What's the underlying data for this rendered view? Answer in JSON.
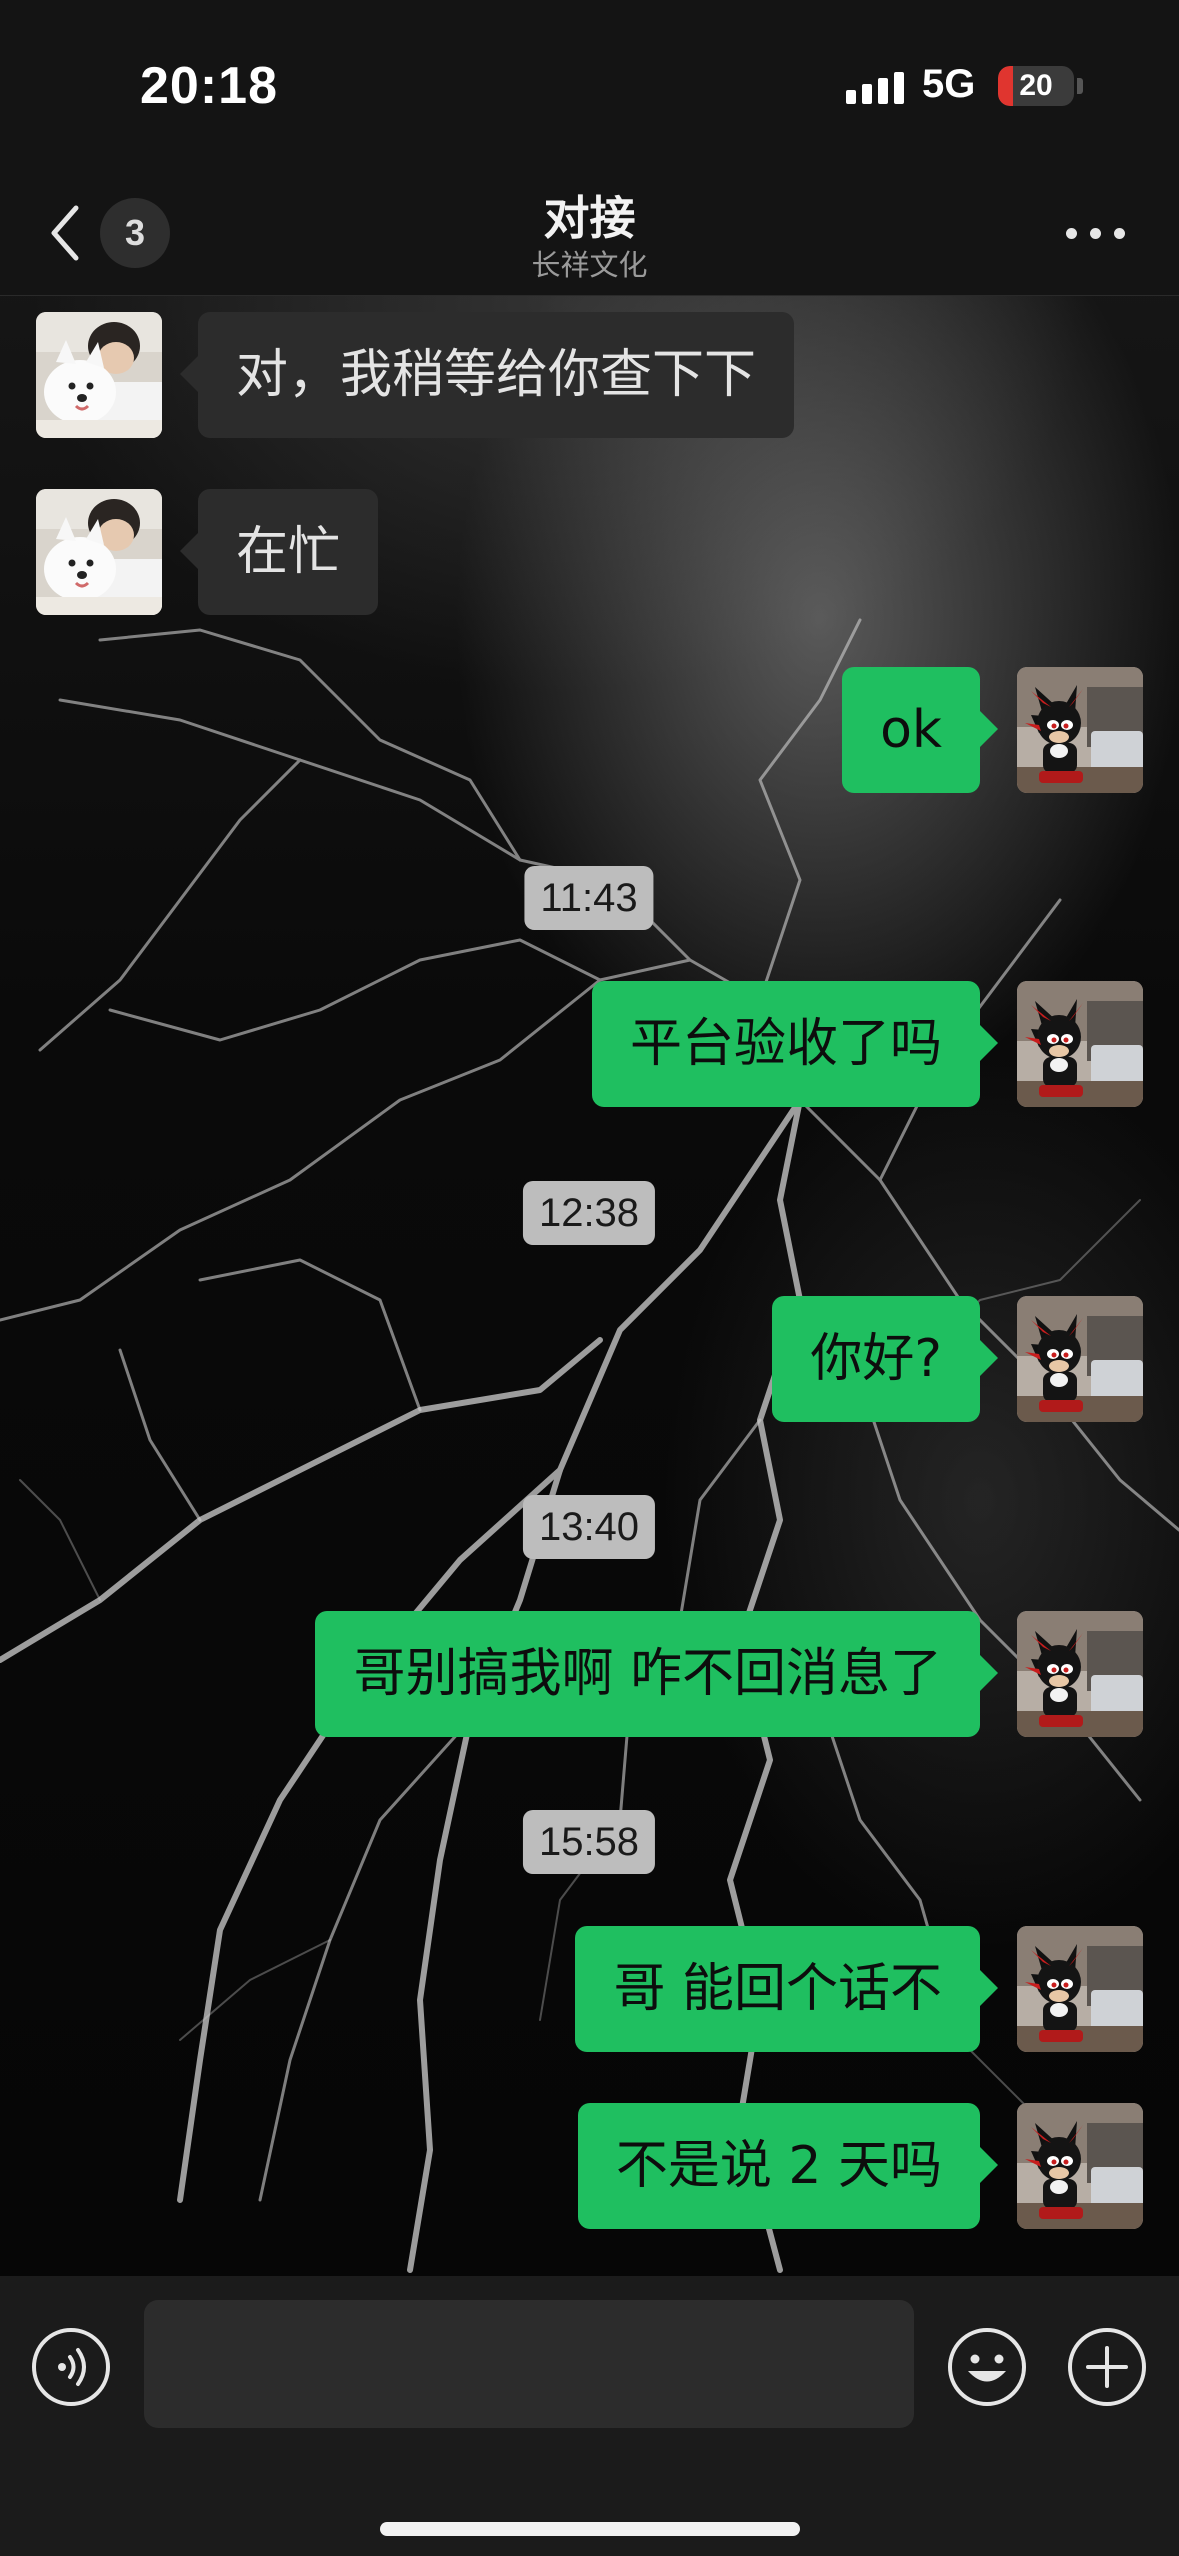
{
  "status_bar": {
    "time": "20:18",
    "network": "5G",
    "battery_level": 20,
    "battery_text": "20",
    "battery_color": "#e0352f"
  },
  "nav": {
    "back_icon": "chevron-left-icon",
    "unread_count": "3",
    "title": "对接",
    "subtitle": "长祥文化",
    "more_icon": "more-dots-icon"
  },
  "colors": {
    "outgoing_bubble": "#1fbf60",
    "incoming_bubble": "#2c2c2c",
    "timestamp_bg": "#bdbdbd"
  },
  "messages": [
    {
      "direction": "in",
      "avatar": "dog-and-person-avatar",
      "text": "对，我稍等给你查下下"
    },
    {
      "direction": "in",
      "avatar": "dog-and-person-avatar",
      "text": "在忙"
    },
    {
      "direction": "out",
      "avatar": "shadow-hedgehog-avatar",
      "text": "ok"
    },
    {
      "type": "time",
      "text": "11:43"
    },
    {
      "direction": "out",
      "avatar": "shadow-hedgehog-avatar",
      "text": "平台验收了吗"
    },
    {
      "type": "time",
      "text": "12:38"
    },
    {
      "direction": "out",
      "avatar": "shadow-hedgehog-avatar",
      "text": "你好?"
    },
    {
      "type": "time",
      "text": "13:40"
    },
    {
      "direction": "out",
      "avatar": "shadow-hedgehog-avatar",
      "text": "哥别搞我啊 咋不回消息了"
    },
    {
      "type": "time",
      "text": "15:58"
    },
    {
      "direction": "out",
      "avatar": "shadow-hedgehog-avatar",
      "text": "哥 能回个话不"
    },
    {
      "direction": "out",
      "avatar": "shadow-hedgehog-avatar",
      "text": "不是说 2 天吗"
    }
  ],
  "input_bar": {
    "voice_icon": "voice-icon",
    "input_value": "",
    "emoji_icon": "emoji-icon",
    "plus_icon": "plus-icon"
  }
}
